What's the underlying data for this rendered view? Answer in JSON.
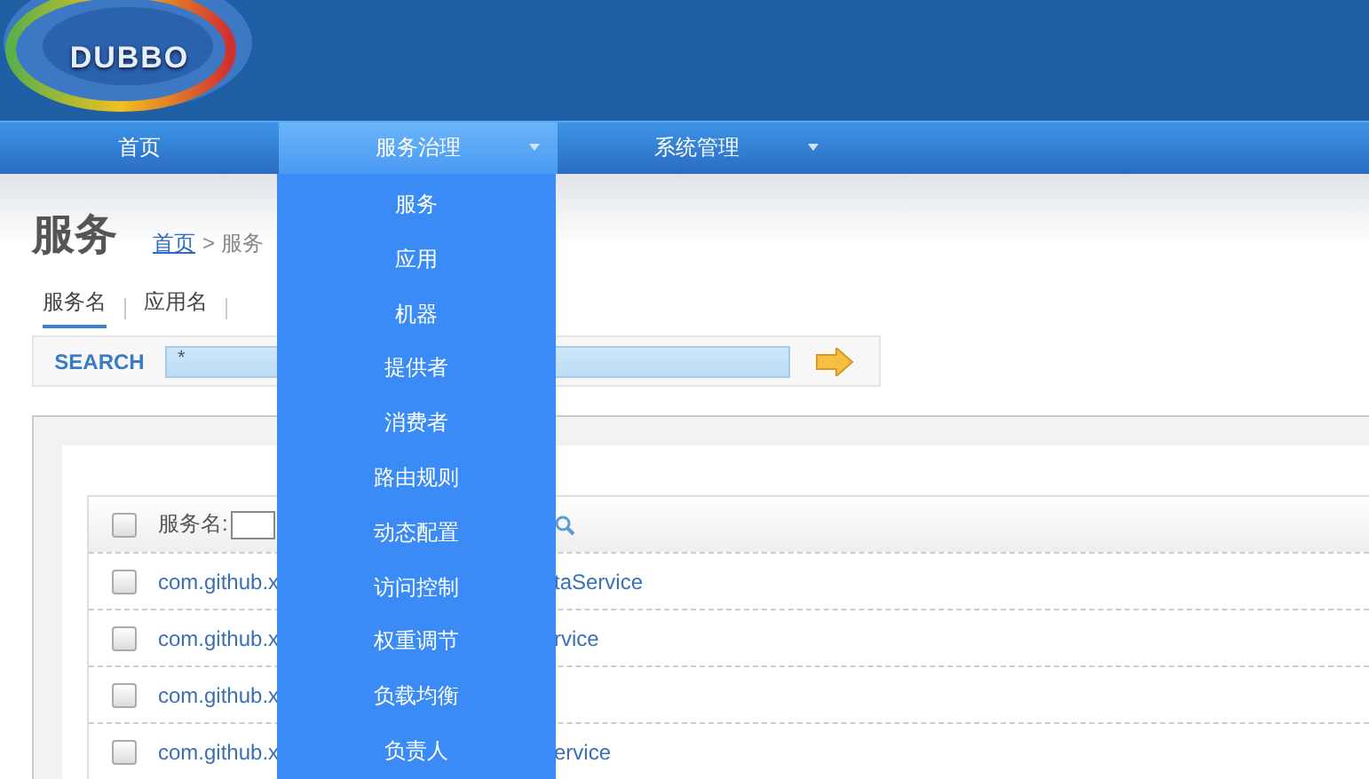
{
  "logo": {
    "text": "DUBBO"
  },
  "nav": [
    {
      "label": "首页",
      "selected": false,
      "has_menu": false
    },
    {
      "label": "服务治理",
      "selected": true,
      "has_menu": true
    },
    {
      "label": "系统管理",
      "selected": false,
      "has_menu": true
    }
  ],
  "dropdown": {
    "items": [
      "服务",
      "应用",
      "机器",
      "提供者",
      "消费者",
      "路由规则",
      "动态配置",
      "访问控制",
      "权重调节",
      "负载均衡",
      "负责人"
    ]
  },
  "page": {
    "title": "服务",
    "breadcrumb": {
      "link": "首页",
      "rest": "> 服务"
    }
  },
  "tabs": [
    {
      "label": "服务名",
      "selected": true
    },
    {
      "label": "应用名",
      "selected": false
    }
  ],
  "search": {
    "label": "SEARCH",
    "value": "*"
  },
  "table": {
    "header": {
      "checked": false,
      "filter_label": "服务名:"
    },
    "rows": [
      {
        "checked": false,
        "name_start": "com.github.x",
        "name_end": "taService"
      },
      {
        "checked": false,
        "name_start": "com.github.x",
        "name_end": "rvice"
      },
      {
        "checked": false,
        "name_start": "com.github.x"
      },
      {
        "checked": false,
        "name_start": "com.github.x",
        "name_end": "ervice"
      }
    ]
  }
}
